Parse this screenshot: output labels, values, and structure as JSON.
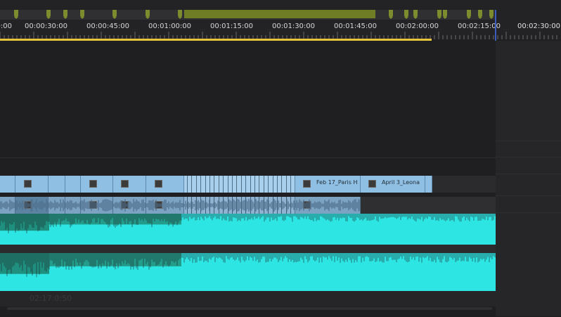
{
  "ruler": {
    "ticks": [
      "00:00:30:00",
      "00:00:45:00",
      "00:01:00:00",
      "00:01:15:00",
      "00:01:30:00",
      "00:01:45:00",
      "00:02:00:00",
      "00:02:15:00"
    ],
    "right_time": "00:02:30:00",
    "marker_color": "#7d8c2d"
  },
  "video_clips": [
    {
      "name": ""
    },
    {
      "name": ""
    },
    {
      "name": ""
    },
    {
      "name": ""
    },
    {
      "name": "Feb 17_Paris H"
    },
    {
      "name": "April 3_Leona"
    }
  ],
  "bottom_bar": {
    "timecode": "02:17:0:50"
  },
  "colors": {
    "video_clip": "#8fc0e4",
    "audio_clip": "#7da3c2",
    "waveform": "#2de0e0",
    "playhead": "#3d5cbf",
    "work_area": "#e7c53b"
  }
}
